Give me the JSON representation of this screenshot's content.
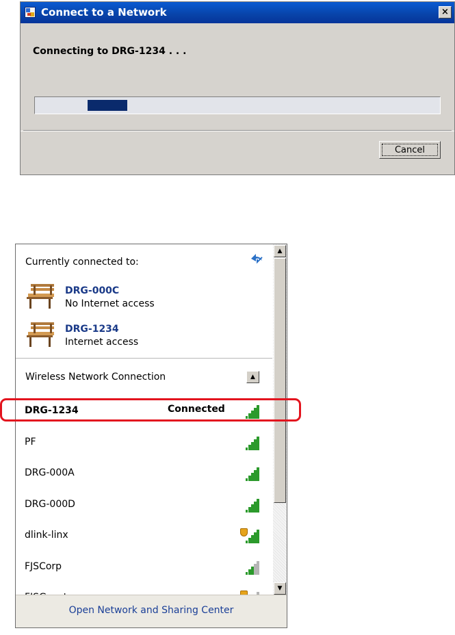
{
  "dialog": {
    "title": "Connect to a Network",
    "close_glyph": "×",
    "status": "Connecting to DRG-1234 . . .",
    "progress_fraction": 0.13,
    "cancel_label": "Cancel"
  },
  "flyout": {
    "currently_connected_label": "Currently connected to:",
    "connections": [
      {
        "name": "DRG-000C",
        "status": "No Internet access",
        "icon": "bench-icon"
      },
      {
        "name": "DRG-1234",
        "status": "Internet access",
        "icon": "bench-icon"
      }
    ],
    "section_label": "Wireless Network Connection",
    "networks": [
      {
        "name": "DRG-1234",
        "state": "Connected",
        "bold": true,
        "secured_warning": false,
        "bars": 5
      },
      {
        "name": "PF",
        "state": "",
        "bold": false,
        "secured_warning": false,
        "bars": 5
      },
      {
        "name": "DRG-000A",
        "state": "",
        "bold": false,
        "secured_warning": false,
        "bars": 5
      },
      {
        "name": "DRG-000D",
        "state": "",
        "bold": false,
        "secured_warning": false,
        "bars": 5
      },
      {
        "name": "dlink-linx",
        "state": "",
        "bold": false,
        "secured_warning": true,
        "bars": 5
      },
      {
        "name": "FJSCorp",
        "state": "",
        "bold": false,
        "secured_warning": false,
        "bars": 3
      },
      {
        "name": "FJSGuest",
        "state": "",
        "bold": false,
        "secured_warning": true,
        "bars": 2
      }
    ],
    "footer_link": "Open Network and Sharing Center"
  },
  "colors": {
    "title_bar": "#0843a8",
    "progress_fill": "#0a2a6c",
    "signal": "#2c9a2c",
    "highlight": "#e3141e",
    "link": "#1a3f97"
  }
}
